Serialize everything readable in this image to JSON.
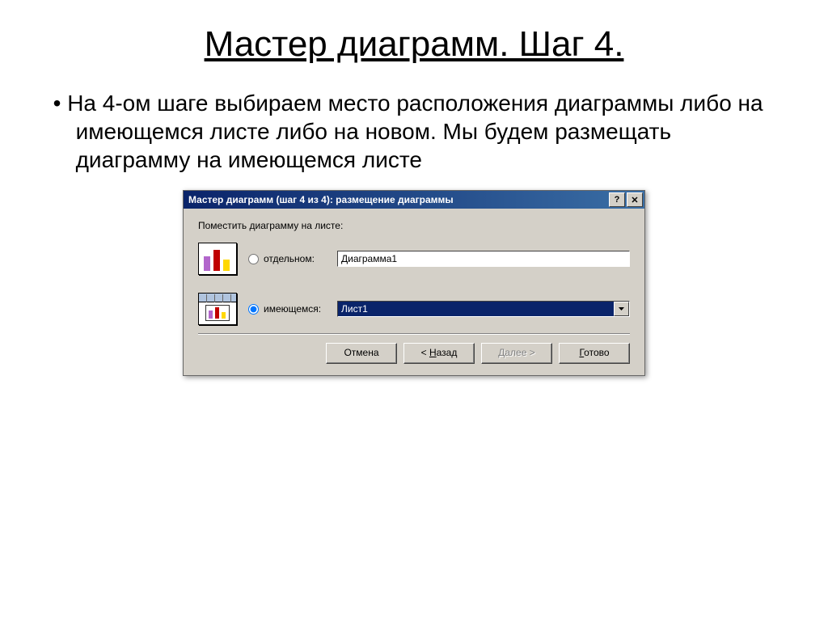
{
  "slide": {
    "title": "Мастер диаграмм. Шаг 4.",
    "bullet": "На 4-ом шаге выбираем место расположения диаграммы либо на имеющемся листе либо на новом. Мы будем размещать диаграмму на имеющемся листе"
  },
  "dialog": {
    "titlebar": "Мастер диаграмм (шаг 4 из 4): размещение диаграммы",
    "help_btn": "?",
    "close_btn": "✕",
    "instruction": "Поместить диаграмму на листе:",
    "option_separate": {
      "label": "отдельном:",
      "value": "Диаграмма1",
      "checked": false
    },
    "option_existing": {
      "label": "имеющемся:",
      "value": "Лист1",
      "checked": true
    },
    "buttons": {
      "cancel": "Отмена",
      "back_prefix": "< ",
      "back_ul": "Н",
      "back_suffix": "азад",
      "next_ul": "Д",
      "next_suffix": "алее >",
      "finish_ul": "Г",
      "finish_suffix": "отово"
    }
  }
}
